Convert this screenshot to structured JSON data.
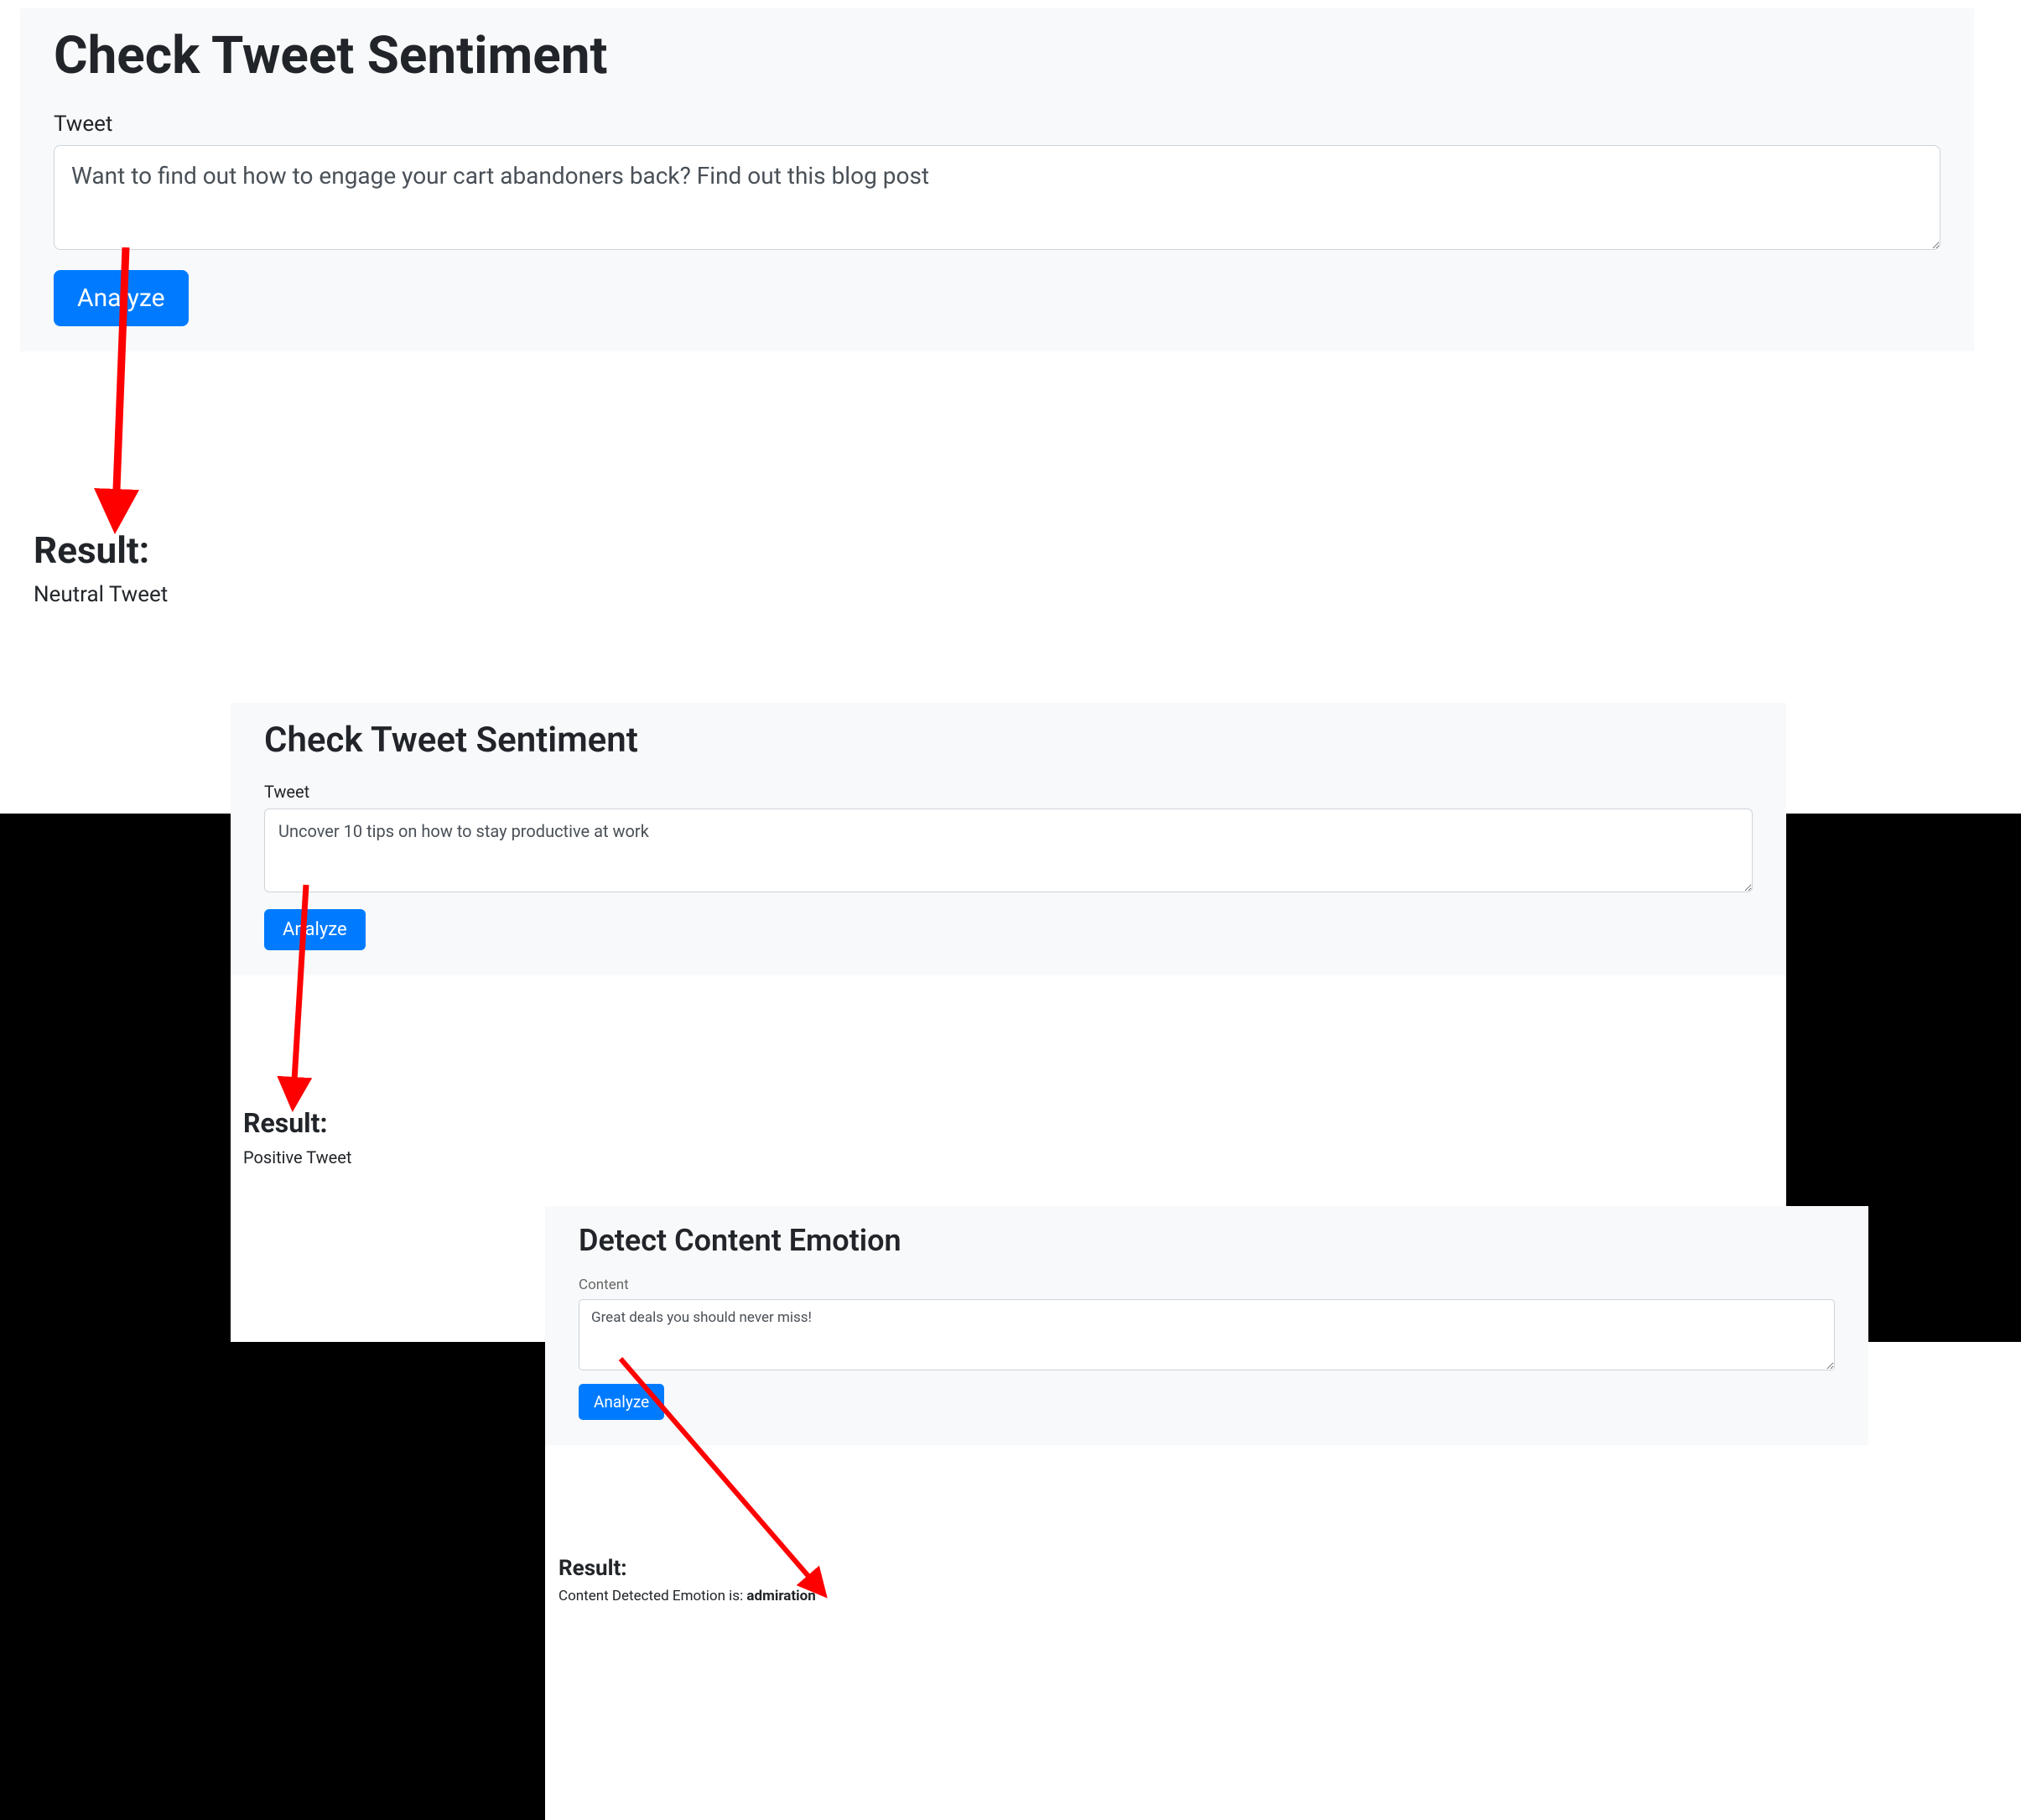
{
  "panel1": {
    "title": "Check Tweet Sentiment",
    "label": "Tweet",
    "textarea_value": "Want to find out how to engage your cart abandoners back? Find out this blog post",
    "button_label": "Analyze",
    "result_heading": "Result:",
    "result_text": "Neutral Tweet"
  },
  "panel2": {
    "title": "Check Tweet Sentiment",
    "label": "Tweet",
    "textarea_value": "Uncover 10 tips on how to stay productive at work",
    "button_label": "Analyze",
    "result_heading": "Result:",
    "result_text": "Positive Tweet"
  },
  "panel3": {
    "title": "Detect Content Emotion",
    "label": "Content",
    "textarea_value": "Great deals you should never miss!",
    "button_label": "Analyze",
    "result_heading": "Result:",
    "result_text_prefix": "Content Detected Emotion is: ",
    "result_text_emotion": "admiration"
  },
  "colors": {
    "primary": "#007bff",
    "panel_bg": "#f8f9fa",
    "arrow": "#ff0000"
  }
}
